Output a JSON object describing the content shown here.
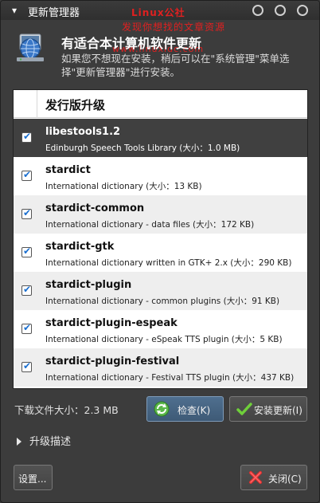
{
  "window": {
    "title": "更新管理器"
  },
  "watermark": {
    "line1": "Linux公社",
    "line2": "发现你想找的文章资源",
    "line3": "www.linuxidc.com"
  },
  "header": {
    "headline": "有适合本计算机软件更新",
    "subtext": "如果您不想现在安装，稍后可以在\"系统管理\"菜单选择\"更新管理器\"进行安装。"
  },
  "list": {
    "column_header": "发行版升级",
    "items": [
      {
        "name": "libestools1.2",
        "desc": "Edinburgh Speech Tools Library (大小：1.0 MB)",
        "checked": true
      },
      {
        "name": "stardict",
        "desc": "International dictionary (大小：13 KB)",
        "checked": true
      },
      {
        "name": "stardict-common",
        "desc": "International dictionary - data files (大小：172 KB)",
        "checked": true
      },
      {
        "name": "stardict-gtk",
        "desc": "International dictionary written in GTK+ 2.x (大小：290 KB)",
        "checked": true
      },
      {
        "name": "stardict-plugin",
        "desc": "International dictionary - common plugins (大小：91 KB)",
        "checked": true
      },
      {
        "name": "stardict-plugin-espeak",
        "desc": "International dictionary - eSpeak TTS plugin (大小：5 KB)",
        "checked": true
      },
      {
        "name": "stardict-plugin-festival",
        "desc": "International dictionary - Festival TTS plugin (大小：437 KB)",
        "checked": true
      }
    ]
  },
  "footer": {
    "download_size": "下载文件大小：2.3 MB",
    "check_label": "检查(K)",
    "install_label": "安装更新(I)",
    "expander_label": "升级描述",
    "settings_label": "设置...",
    "close_label": "关闭(C)"
  },
  "colors": {
    "selection": "#404040",
    "accent_button": "#4f6f8f",
    "watermark": "#e02020"
  },
  "icons": {
    "app": "network-globe-icon",
    "check": "refresh-icon",
    "install": "checkmark-icon",
    "close": "red-x-icon"
  }
}
